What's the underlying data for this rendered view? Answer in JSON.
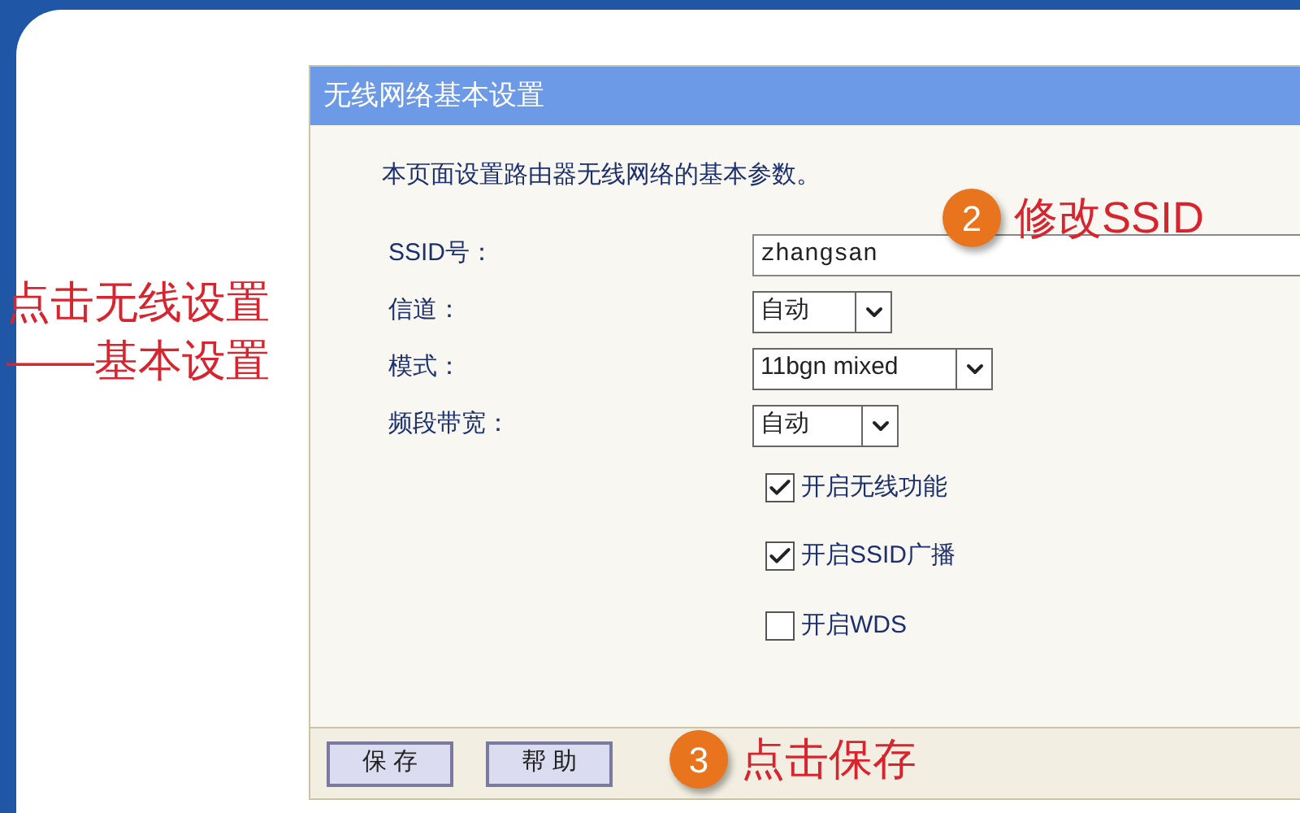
{
  "panel": {
    "title": "无线网络基本设置",
    "intro": "本页面设置路由器无线网络的基本参数。",
    "fields": [
      {
        "kind": "text",
        "label": "SSID号：",
        "value": "zhangsan"
      },
      {
        "kind": "select",
        "label": "信道：",
        "value": "自动"
      },
      {
        "kind": "select",
        "label": "模式：",
        "value": "11bgn mixed"
      },
      {
        "kind": "select",
        "label": "频段带宽：",
        "value": "自动"
      }
    ],
    "checkboxes": [
      {
        "label": "开启无线功能",
        "checked": true
      },
      {
        "label": "开启SSID广播",
        "checked": true
      },
      {
        "label": "开启WDS",
        "checked": false
      }
    ],
    "buttons": [
      "保 存",
      "帮 助"
    ]
  },
  "annotations": [
    {
      "kind": "note",
      "lines": [
        "点击无线设置",
        "——基本设置"
      ]
    },
    {
      "kind": "step",
      "number": "2",
      "text": "修改SSID"
    },
    {
      "kind": "step",
      "number": "3",
      "text": "点击保存"
    }
  ]
}
